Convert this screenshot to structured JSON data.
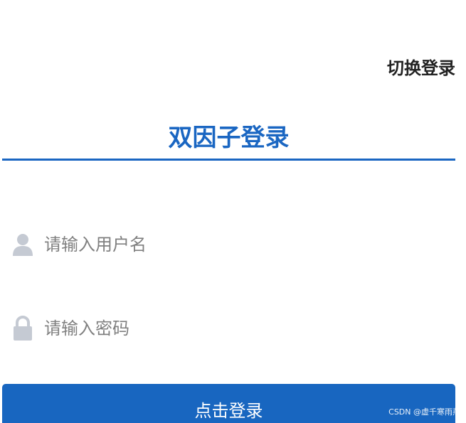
{
  "header": {
    "switch_login": "切换登录"
  },
  "form": {
    "title": "双因子登录",
    "username": {
      "placeholder": "请输入用户名",
      "value": "",
      "icon": "user-icon"
    },
    "password": {
      "placeholder": "请输入密码",
      "value": "",
      "icon": "lock-icon"
    },
    "submit_label": "点击登录"
  },
  "watermark": "CSDN @虚千寒雨燕",
  "colors": {
    "primary": "#1a66c2",
    "icon": "#c5cad3",
    "placeholder": "#808080"
  }
}
